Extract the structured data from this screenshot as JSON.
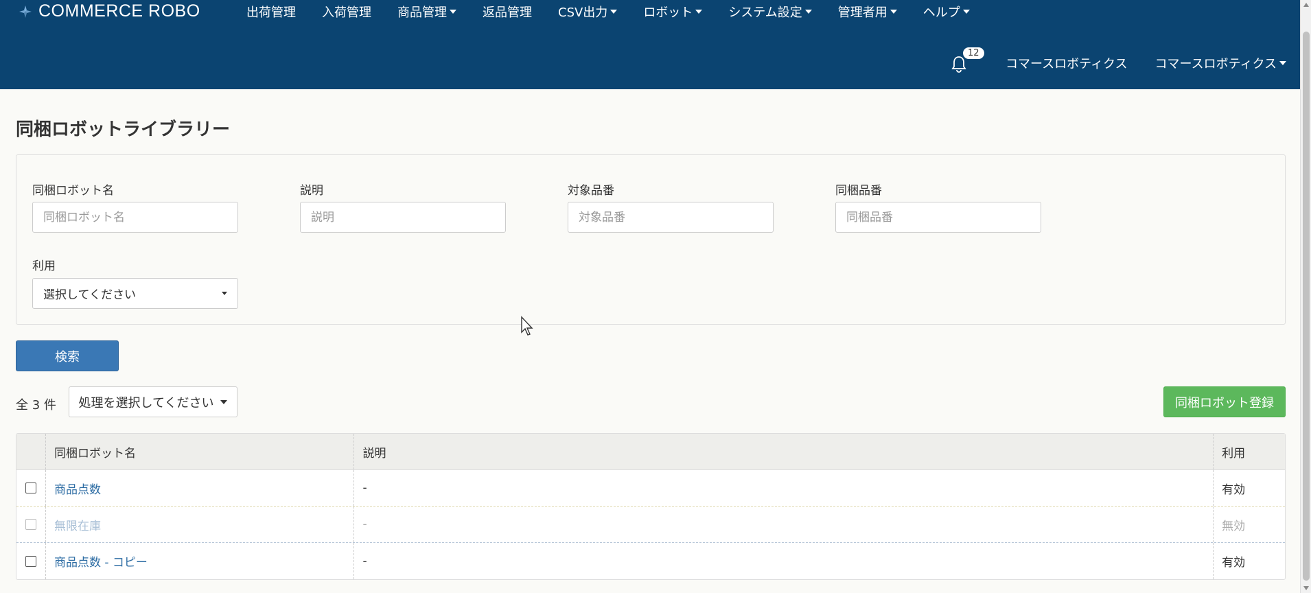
{
  "app": {
    "brand": "COMMERCE ROBO",
    "nav": [
      {
        "label": "出荷管理",
        "dropdown": false
      },
      {
        "label": "入荷管理",
        "dropdown": false
      },
      {
        "label": "商品管理",
        "dropdown": true
      },
      {
        "label": "返品管理",
        "dropdown": false
      },
      {
        "label": "CSV出力",
        "dropdown": true
      },
      {
        "label": "ロボット",
        "dropdown": true
      },
      {
        "label": "システム設定",
        "dropdown": true
      },
      {
        "label": "管理者用",
        "dropdown": true
      },
      {
        "label": "ヘルプ",
        "dropdown": true
      }
    ],
    "notifications": "12",
    "company": "コマースロボティクス",
    "user_menu": "コマースロボティクス"
  },
  "page": {
    "title": "同梱ロボットライブラリー"
  },
  "search": {
    "fields": [
      {
        "label": "同梱ロボット名",
        "placeholder": "同梱ロボット名",
        "value": ""
      },
      {
        "label": "説明",
        "placeholder": "説明",
        "value": ""
      },
      {
        "label": "対象品番",
        "placeholder": "対象品番",
        "value": ""
      },
      {
        "label": "同梱品番",
        "placeholder": "同梱品番",
        "value": ""
      }
    ],
    "usage_label": "利用",
    "usage_selected": "選択してください",
    "button": "検索"
  },
  "results": {
    "count_text": "全 3 件",
    "action_select": "処理を選択してください",
    "register_button": "同梱ロボット登録",
    "columns": [
      "同梱ロボット名",
      "説明",
      "利用"
    ],
    "rows": [
      {
        "name": "商品点数",
        "description": "-",
        "usage": "有効",
        "disabled": false
      },
      {
        "name": "無限在庫",
        "description": "-",
        "usage": "無効",
        "disabled": true
      },
      {
        "name": "商品点数 - コピー",
        "description": "-",
        "usage": "有効",
        "disabled": false
      }
    ]
  },
  "colors": {
    "navbar": "#0b4471",
    "primary_button": "#3a78b5",
    "success_button": "#5cb85c",
    "link": "#2e6da4"
  }
}
